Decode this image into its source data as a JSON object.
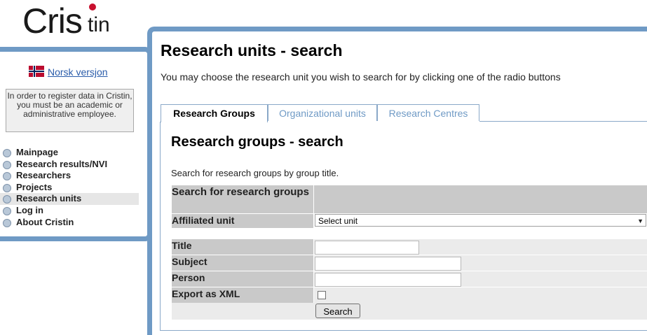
{
  "logo": {
    "part1": "Cris",
    "part2": "tin"
  },
  "sidebar": {
    "norsk_link": "Norsk versjon",
    "notice": "In order to register data in Cristin, you must be an academic or administrative employee.",
    "nav": [
      {
        "label": "Mainpage"
      },
      {
        "label": "Research results/NVI"
      },
      {
        "label": "Researchers"
      },
      {
        "label": "Projects"
      },
      {
        "label": "Research units",
        "active": true
      },
      {
        "label": "Log in"
      },
      {
        "label": "About Cristin"
      }
    ]
  },
  "main": {
    "title": "Research units - search",
    "intro": "You may choose the research unit you wish to search for by clicking one of the radio buttons",
    "tabs": [
      {
        "label": "Research Groups",
        "active": true
      },
      {
        "label": "Organizational units"
      },
      {
        "label": "Research Centres"
      }
    ],
    "panel": {
      "title": "Research groups - search",
      "description": "Search for research groups by group title.",
      "form": {
        "heading": "Search for research groups",
        "affiliated_label": "Affiliated unit",
        "affiliated_value": "Select unit",
        "title_label": "Title",
        "title_value": "",
        "subject_label": "Subject",
        "subject_value": "",
        "person_label": "Person",
        "person_value": "",
        "export_label": "Export as XML",
        "export_checked": false,
        "search_button": "Search"
      }
    }
  }
}
